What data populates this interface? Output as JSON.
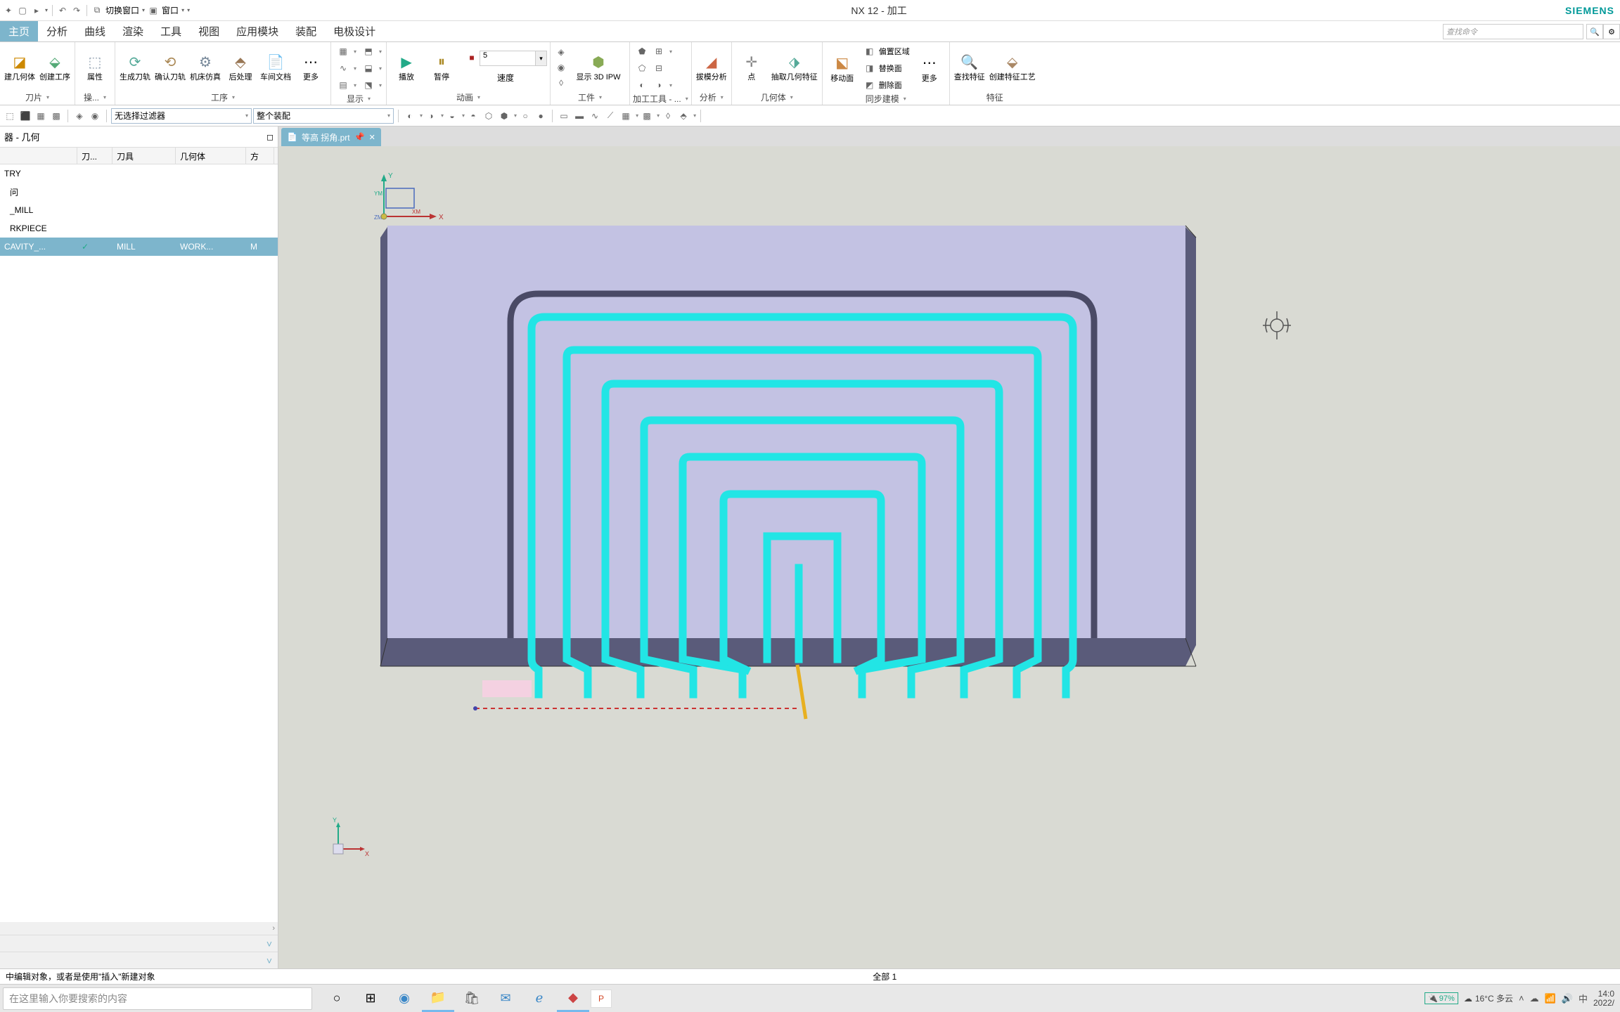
{
  "title": "NX 12 - 加工",
  "brand": "SIEMENS",
  "quickAccess": {
    "switchWindow": "切换窗口",
    "windowMenu": "窗口"
  },
  "menu": {
    "items": [
      "主页",
      "分析",
      "曲线",
      "渲染",
      "工具",
      "视图",
      "应用模块",
      "装配",
      "电极设计"
    ],
    "activeIndex": 0,
    "searchPlaceholder": "查找命令"
  },
  "ribbon": {
    "groups": {
      "insert": {
        "label": "刀片",
        "btnA": "建几何体",
        "btnB": "创建工序"
      },
      "attr": {
        "label": "操...",
        "btn": "属性"
      },
      "process": {
        "label": "工序",
        "gen": "生成刀轨",
        "confirm": "确认刀轨",
        "sim": "机床仿真",
        "post": "后处理",
        "shop": "车间文档",
        "more": "更多"
      },
      "display": {
        "label": "显示"
      },
      "anim": {
        "label": "动画",
        "play": "播放",
        "pause": "暂停",
        "speedLabel": "速度",
        "speedValue": "5"
      },
      "part": {
        "label": "工件",
        "show3d": "显示 3D IPW"
      },
      "tools": {
        "label": "加工工具 - ..."
      },
      "analysis": {
        "label": "分析",
        "draft": "拔模分析"
      },
      "geom": {
        "label": "几何体",
        "point": "点",
        "extract": "抽取几何特征"
      },
      "sync": {
        "label": "同步建模",
        "move": "移动面",
        "offset": "偏置区域",
        "replace": "替换面",
        "delete": "删除面",
        "more": "更多"
      },
      "feature": {
        "label": "特征",
        "find": "查找特征",
        "create": "创建特征工艺"
      }
    }
  },
  "filters": {
    "noFilter": "无选择过滤器",
    "assembly": "整个装配"
  },
  "leftPanel": {
    "title": "器 - 几何",
    "headers": [
      "刀...",
      "刀具",
      "几何体",
      "方"
    ],
    "rows": [
      {
        "name": "TRY",
        "cells": [
          "",
          "",
          "",
          ""
        ]
      },
      {
        "name": "问",
        "cells": [
          "",
          "",
          "",
          ""
        ]
      },
      {
        "name": "_MILL",
        "cells": [
          "",
          "",
          "",
          ""
        ]
      },
      {
        "name": "RKPIECE",
        "cells": [
          "",
          "",
          "",
          ""
        ]
      },
      {
        "name": "CAVITY_...",
        "cells": [
          "✓",
          "MILL",
          "WORK...",
          "M"
        ],
        "selected": true
      }
    ]
  },
  "docTab": {
    "name": "等高 拐角.prt"
  },
  "statusBar": {
    "left": "中编辑对象，或者是使用\"插入\"新建对象",
    "center": "全部 1"
  },
  "taskbar": {
    "searchPlaceholder": "在这里输入你要搜索的内容",
    "battery": "97%",
    "weather": "16°C 多云",
    "ime": "中",
    "time": "14:0",
    "date": "2022/"
  }
}
